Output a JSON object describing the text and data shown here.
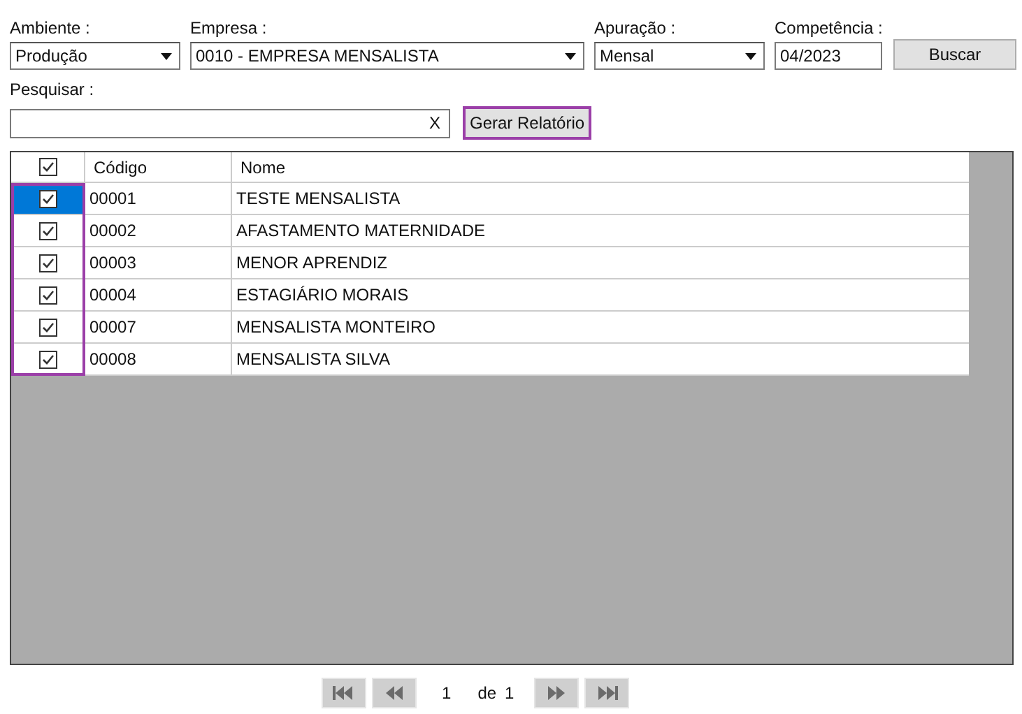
{
  "filters": [
    {
      "label": "Ambiente :",
      "value": "Produção",
      "kind": "dropdown"
    },
    {
      "label": "Empresa :",
      "value": "0010 - EMPRESA MENSALISTA",
      "kind": "dropdown"
    },
    {
      "label": "Apuração :",
      "value": "Mensal",
      "kind": "dropdown"
    },
    {
      "label": "Competência :",
      "value": "04/2023",
      "kind": "text"
    }
  ],
  "search_button": "Buscar",
  "search": {
    "label": "Pesquisar :",
    "clear": "X"
  },
  "report_button": "Gerar Relatório",
  "table": {
    "header_checked": true,
    "columns": [
      "Código",
      "Nome"
    ],
    "rows": [
      {
        "code": "00001",
        "name": "TESTE MENSALISTA",
        "checked": true,
        "selected": true
      },
      {
        "code": "00002",
        "name": "AFASTAMENTO MATERNIDADE",
        "checked": true,
        "selected": false
      },
      {
        "code": "00003",
        "name": "MENOR APRENDIZ",
        "checked": true,
        "selected": false
      },
      {
        "code": "00004",
        "name": "ESTAGIÁRIO MORAIS",
        "checked": true,
        "selected": false
      },
      {
        "code": "00007",
        "name": "MENSALISTA MONTEIRO",
        "checked": true,
        "selected": false
      },
      {
        "code": "00008",
        "name": "MENSALISTA SILVA",
        "checked": true,
        "selected": false
      }
    ]
  },
  "pager": {
    "page": "1",
    "of": "de",
    "total": "1"
  }
}
